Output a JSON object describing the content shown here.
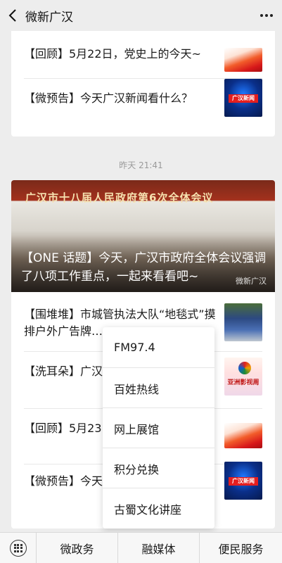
{
  "header": {
    "title": "微新广汉"
  },
  "card1": {
    "items": [
      {
        "text": "【回顾】5月22日，党史上的今天~"
      },
      {
        "text": "【微预告】今天广汉新闻看什么？",
        "thumb_label": "广汉新闻"
      }
    ]
  },
  "timestamp": "昨天 21:41",
  "banner": {
    "image_caption": "广汉市十八届人民政府第6次全体会议",
    "headline": "【ONE 话题】今天，广汉市政府全体会议强调了八项工作重点，一起来看看吧~",
    "source": "微新广汉"
  },
  "card2": {
    "items": [
      {
        "text": "【围堆堆】市城管执法大队“地毯式”摸排户外广告牌…"
      },
      {
        "text": "【洗耳朵】广汉…歌—亚洲电影周…",
        "thumb_label": "亚洲影视周"
      },
      {
        "text": "【回顾】5月23…"
      },
      {
        "text": "【微预告】今天…",
        "thumb_label": "广汉新闻"
      }
    ]
  },
  "popup": {
    "items": [
      "FM97.4",
      "百姓热线",
      "网上展馆",
      "积分兑换",
      "古蜀文化讲座"
    ]
  },
  "bottom": {
    "tabs": [
      "微政务",
      "融媒体",
      "便民服务"
    ]
  }
}
